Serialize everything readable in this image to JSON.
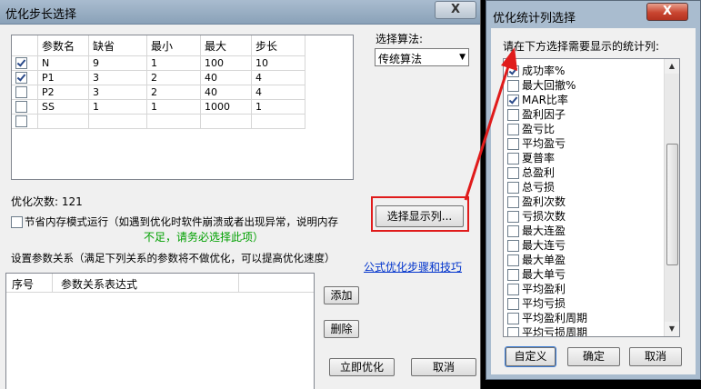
{
  "main": {
    "title": "优化步长选择",
    "close_label": "X",
    "grid": {
      "headers": [
        "参数名",
        "缺省",
        "最小",
        "最大",
        "步长"
      ],
      "rows": [
        {
          "checked": true,
          "name": "N",
          "default": "9",
          "min": "1",
          "max": "100",
          "step": "10"
        },
        {
          "checked": true,
          "name": "P1",
          "default": "3",
          "min": "2",
          "max": "40",
          "step": "4"
        },
        {
          "checked": false,
          "name": "P2",
          "default": "3",
          "min": "2",
          "max": "40",
          "step": "4"
        },
        {
          "checked": false,
          "name": "SS",
          "default": "1",
          "min": "1",
          "max": "1000",
          "step": "1"
        }
      ]
    },
    "algo_label": "选择算法:",
    "algo_value": "传统算法",
    "opt_count": "优化次数: 121",
    "select_columns_btn": "选择显示列...",
    "save_memory_label": "节省内存模式运行（如遇到优化时软件崩溃或者出现异常，说明内存",
    "save_memory_note": "不足，请务必选择此项）",
    "relation_label": "设置参数关系（满足下列关系的参数将不做优化，可以提高优化速度）",
    "formula_link": "公式优化步骤和技巧",
    "relation_headers": [
      "序号",
      "参数关系表达式"
    ],
    "add_btn": "添加",
    "delete_btn": "删除",
    "optimize_btn": "立即优化",
    "cancel_btn": "取消",
    "colors": {
      "note_green": "#00a000",
      "highlight_red": "#e01b1b",
      "link_blue": "#0033cc"
    }
  },
  "columns": {
    "title": "优化统计列选择",
    "close_label": "X",
    "prompt": "请在下方选择需要显示的统计列:",
    "items": [
      {
        "label": "成功率%",
        "checked": true
      },
      {
        "label": "最大回撤%",
        "checked": false
      },
      {
        "label": "MAR比率",
        "checked": true
      },
      {
        "label": "盈利因子",
        "checked": false
      },
      {
        "label": "盈亏比",
        "checked": false
      },
      {
        "label": "平均盈亏",
        "checked": false
      },
      {
        "label": "夏普率",
        "checked": false
      },
      {
        "label": "总盈利",
        "checked": false
      },
      {
        "label": "总亏损",
        "checked": false
      },
      {
        "label": "盈利次数",
        "checked": false
      },
      {
        "label": "亏损次数",
        "checked": false
      },
      {
        "label": "最大连盈",
        "checked": false
      },
      {
        "label": "最大连亏",
        "checked": false
      },
      {
        "label": "最大单盈",
        "checked": false
      },
      {
        "label": "最大单亏",
        "checked": false
      },
      {
        "label": "平均盈利",
        "checked": false
      },
      {
        "label": "平均亏损",
        "checked": false
      },
      {
        "label": "平均盈利周期",
        "checked": false
      },
      {
        "label": "平均亏损周期",
        "checked": false
      }
    ],
    "ok_label": "自定义",
    "confirm_label": "确定",
    "cancel_label": "取消"
  }
}
